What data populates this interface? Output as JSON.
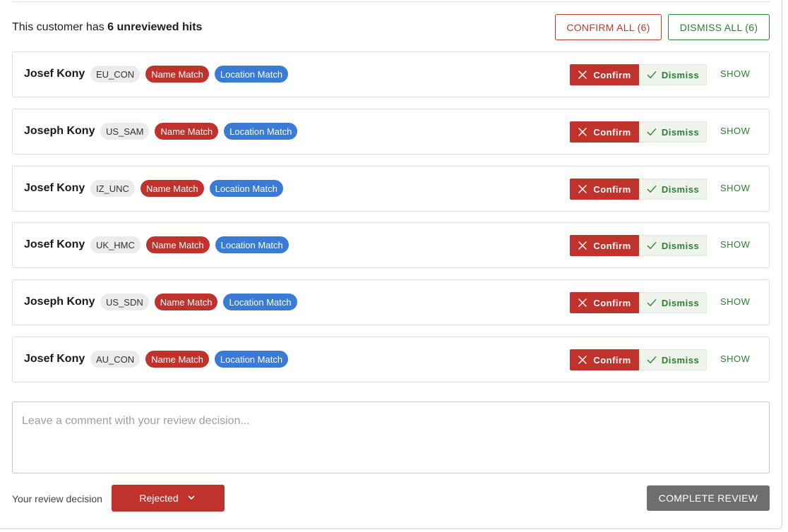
{
  "summary": {
    "prefix": "This customer has",
    "count_text": "6 unreviewed hits"
  },
  "bulk_actions": {
    "confirm_all": "CONFIRM ALL (6)",
    "dismiss_all": "DISMISS ALL (6)"
  },
  "hits": [
    {
      "name": "Josef Kony",
      "source": "EU_CON",
      "tags": [
        "Name Match",
        "Location Match"
      ]
    },
    {
      "name": "Joseph Kony",
      "source": "US_SAM",
      "tags": [
        "Name Match",
        "Location Match"
      ]
    },
    {
      "name": "Josef Kony",
      "source": "IZ_UNC",
      "tags": [
        "Name Match",
        "Location Match"
      ]
    },
    {
      "name": "Josef Kony",
      "source": "UK_HMC",
      "tags": [
        "Name Match",
        "Location Match"
      ]
    },
    {
      "name": "Joseph Kony",
      "source": "US_SDN",
      "tags": [
        "Name Match",
        "Location Match"
      ]
    },
    {
      "name": "Josef Kony",
      "source": "AU_CON",
      "tags": [
        "Name Match",
        "Location Match"
      ]
    }
  ],
  "hit_actions": {
    "confirm": "Confirm",
    "dismiss": "Dismiss",
    "show": "SHOW"
  },
  "comment": {
    "placeholder": "Leave a comment with your review decision...",
    "value": ""
  },
  "decision": {
    "label": "Your review decision",
    "selected": "Rejected"
  },
  "complete_button": "COMPLETE REVIEW",
  "colors": {
    "confirm_red": "#c0322c",
    "dismiss_green": "#2e7d32",
    "location_blue": "#3a7bd5",
    "complete_gray": "#6e6e6e"
  },
  "icons": {
    "confirm": "close-icon",
    "dismiss": "check-icon",
    "decision": "chevron-down-icon"
  }
}
